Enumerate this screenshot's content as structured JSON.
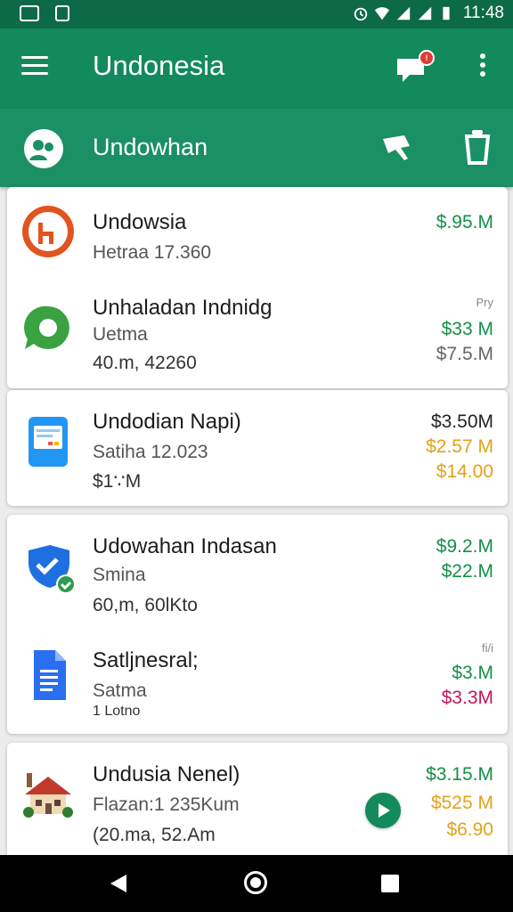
{
  "status_bar": {
    "time": "11:48"
  },
  "app_bar": {
    "title": "Undonesia",
    "notification_badge": "!"
  },
  "sub_bar": {
    "title": "Undowhan"
  },
  "items": [
    {
      "icon": "brand-logo-icon",
      "line1": "Undowsia",
      "line2": "Hetraa 17.360",
      "amounts": [
        {
          "text": "$.95.M",
          "color": "#139047"
        }
      ]
    },
    {
      "icon": "chat-bubble-icon",
      "line1": "Unhaladan Indnidg",
      "line2": "Uetma",
      "line3": "40.m, 42260",
      "amount_label": "Pry",
      "amounts": [
        {
          "text": "$33 M",
          "color": "#139047"
        },
        {
          "text": "$7.5.M",
          "color": "#666666"
        }
      ]
    },
    {
      "icon": "document-card-icon",
      "line1": "Undodian Napi)",
      "line2": "Satiha 12.023",
      "line3": "$1∵M",
      "amounts": [
        {
          "text": "$3.50M",
          "color": "#222222"
        },
        {
          "text": "$2.57 M",
          "color": "#e3a21a"
        },
        {
          "text": "$14.00",
          "color": "#e3a21a"
        }
      ]
    },
    {
      "icon": "shield-check-icon",
      "line1": "Udowahan Indasan",
      "line2": "Smina",
      "line3": "60,m, 60lKto",
      "amounts": [
        {
          "text": "$9.2.M",
          "color": "#139047"
        },
        {
          "text": "$22.M",
          "color": "#139047"
        }
      ]
    },
    {
      "icon": "doc-file-icon",
      "line1": "Satljnesral;",
      "line2": "Satma",
      "line3": "1 Lotno",
      "amount_label": "fi/i",
      "amounts": [
        {
          "text": "$3.M",
          "color": "#139047"
        },
        {
          "text": "$3.3M",
          "color": "#c2185b"
        }
      ]
    },
    {
      "icon": "house-icon",
      "line1": "Undusia Nenel)",
      "line2": "Flazan:1 235Kum",
      "line3": "(20.ma, 52.Am",
      "amounts": [
        {
          "text": "$3.15.M",
          "color": "#139047"
        },
        {
          "text": "$525 M",
          "color": "#e3a21a"
        },
        {
          "text": "$6.90",
          "color": "#e3a21a"
        }
      ]
    }
  ]
}
